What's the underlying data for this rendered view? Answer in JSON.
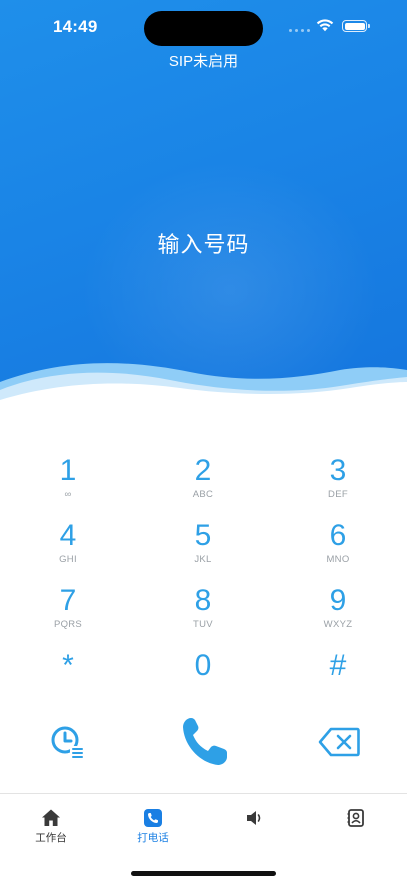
{
  "status_bar": {
    "time": "14:49"
  },
  "header": {
    "sip_status": "SIP未启用",
    "number_placeholder": "输入号码"
  },
  "keypad": {
    "keys": [
      {
        "digit": "1",
        "letters": "∞"
      },
      {
        "digit": "2",
        "letters": "ABC"
      },
      {
        "digit": "3",
        "letters": "DEF"
      },
      {
        "digit": "4",
        "letters": "GHI"
      },
      {
        "digit": "5",
        "letters": "JKL"
      },
      {
        "digit": "6",
        "letters": "MNO"
      },
      {
        "digit": "7",
        "letters": "PQRS"
      },
      {
        "digit": "8",
        "letters": "TUV"
      },
      {
        "digit": "9",
        "letters": "WXYZ"
      },
      {
        "digit": "*",
        "letters": ""
      },
      {
        "digit": "0",
        "letters": ""
      },
      {
        "digit": "#",
        "letters": ""
      }
    ]
  },
  "actions": {
    "history_icon": "clock-list-icon",
    "call_icon": "phone-icon",
    "backspace_icon": "backspace-icon"
  },
  "tabbar": {
    "tabs": [
      {
        "label": "工作台",
        "icon": "home-icon"
      },
      {
        "label": "打电话",
        "icon": "phone-square-icon"
      },
      {
        "label": "",
        "icon": "speaker-icon"
      },
      {
        "label": "",
        "icon": "contacts-icon"
      }
    ],
    "active_index": 1
  },
  "colors": {
    "primary": "#1a84e6",
    "accent": "#2ea0e6",
    "tab_active": "#1a7fe3"
  }
}
